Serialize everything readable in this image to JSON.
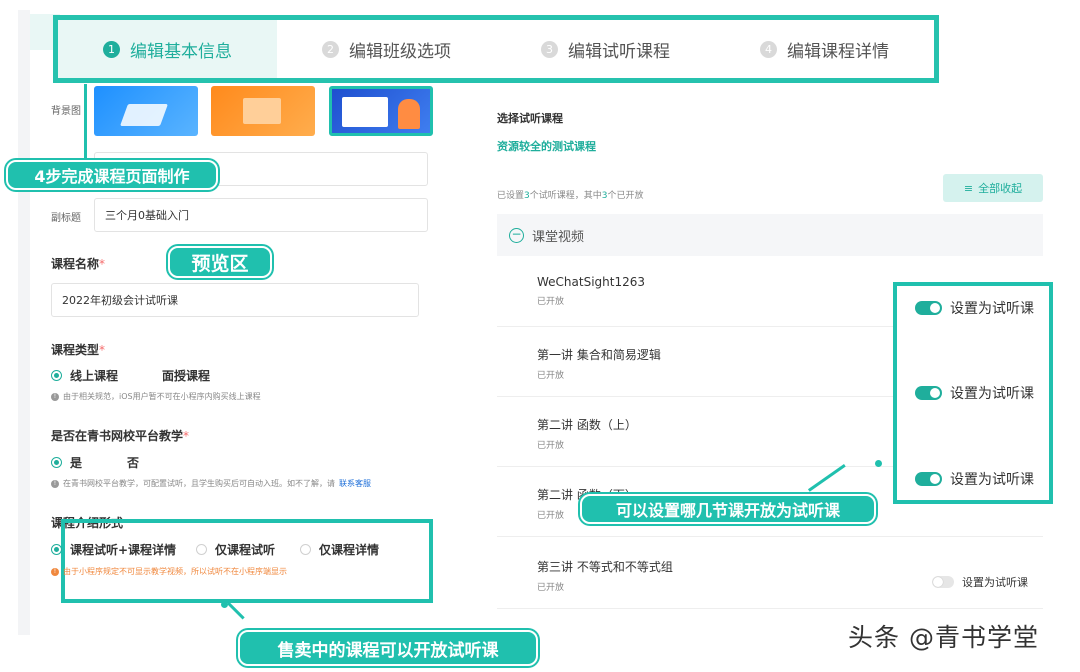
{
  "steps": [
    {
      "num": "1",
      "label": "编辑基本信息",
      "active": true
    },
    {
      "num": "2",
      "label": "编辑班级选项",
      "active": false
    },
    {
      "num": "3",
      "label": "编辑试听课程",
      "active": false
    },
    {
      "num": "4",
      "label": "编辑课程详情",
      "active": false
    }
  ],
  "form": {
    "bg_label": "背景图",
    "subtitle_label": "副标题",
    "subtitle_value": "三个月0基础入门",
    "course_name_label": "课程名称",
    "required_mark": "*",
    "course_name_value": "2022年初级会计试听课",
    "course_type_label": "课程类型",
    "course_type_options": [
      "线上课程",
      "面授课程"
    ],
    "course_type_tip": "由于相关规范，iOS用户暂不可在小程序内购买线上课程",
    "platform_label": "是否在青书网校平台教学",
    "platform_options": [
      "是",
      "否"
    ],
    "platform_tip": "在青书网校平台教学，可配置试听，且学生购买后可自动入班。如不了解，请",
    "platform_tip_link": "联系客服",
    "intro_label": "课程介绍形式",
    "intro_options": [
      "课程试听+课程详情",
      "仅课程试听",
      "仅课程详情"
    ],
    "intro_tip": "由于小程序规定不可显示教学视频，所以试听不在小程序端显示"
  },
  "callouts": {
    "steps": "4步完成课程页面制作",
    "preview": "预览区",
    "trial_open": "可以设置哪几节课开放为试听课",
    "on_sale": "售卖中的课程可以开放试听课"
  },
  "right": {
    "title": "选择试听课程",
    "course": "资源较全的测试课程",
    "status_prefix": "已设置",
    "status_count1": "3",
    "status_mid": "个试听课程，其中",
    "status_count2": "3",
    "status_suffix": "个已开放",
    "collapse_label": "全部收起",
    "section": "课堂视频",
    "lessons": [
      {
        "name": "WeChatSight1263",
        "status": "已开放"
      },
      {
        "name": "第一讲 集合和简易逻辑",
        "status": "已开放"
      },
      {
        "name": "第二讲 函数（上）",
        "status": "已开放"
      },
      {
        "name": "第二讲 函数（下）",
        "status": "已开放"
      },
      {
        "name": "第三讲 不等式和不等式组",
        "status": "已开放"
      }
    ],
    "toggle_label": "设置为试听课"
  },
  "watermark": "头条 @青书学堂",
  "colors": {
    "accent": "#20c0ae",
    "accent_dark": "#1fae9c",
    "light": "#e9f7f5"
  }
}
